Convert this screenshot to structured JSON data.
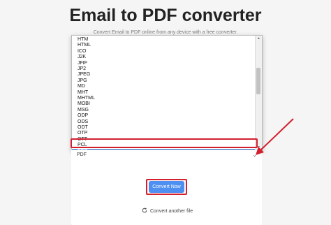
{
  "header": {
    "title": "Email to PDF converter",
    "subtitle": "Convert Email to PDF online from any device with a free converter."
  },
  "format_list": {
    "options": [
      "HTM",
      "HTML",
      "ICO",
      "J2K",
      "JFIF",
      "JP2",
      "JPEG",
      "JPG",
      "MD",
      "MHT",
      "MHTML",
      "MOBI",
      "MSG",
      "ODP",
      "ODS",
      "ODT",
      "OTP",
      "OTT",
      "PCL",
      "PDF"
    ],
    "selected": "PDF"
  },
  "select": {
    "value": "PDF",
    "chevron_icon": "chevron-down-icon"
  },
  "actions": {
    "convert_label": "Convert Now",
    "convert_another_label": "Convert another file",
    "convert_another_icon": "refresh-icon"
  },
  "colors": {
    "accent": "#4e8ff2",
    "selected_option": "#1a63c6",
    "highlight": "#d3202f"
  }
}
